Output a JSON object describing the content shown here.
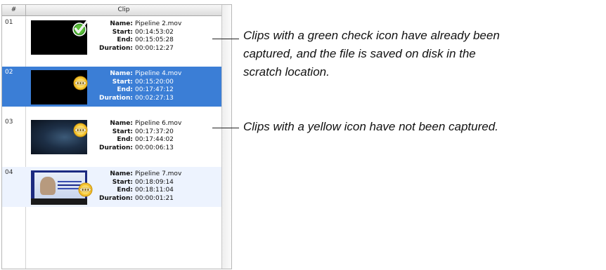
{
  "table": {
    "col_number": "#",
    "col_clip": "Clip",
    "field_labels": {
      "name": "Name:",
      "start": "Start:",
      "end": "End:",
      "duration": "Duration:"
    },
    "rows": [
      {
        "number": "01",
        "name": "Pipeline 2.mov",
        "start": "00:14:53:02",
        "end": "00:15:05:28",
        "duration": "00:00:12:27",
        "status": "captured",
        "icon": "green-check-icon"
      },
      {
        "number": "02",
        "name": "Pipeline 4.mov",
        "start": "00:15:20:00",
        "end": "00:17:47:12",
        "duration": "00:02:27:13",
        "status": "not-captured",
        "icon": "yellow-icon",
        "selected": true
      },
      {
        "number": "03",
        "name": "Pipeline 6.mov",
        "start": "00:17:37:20",
        "end": "00:17:44:02",
        "duration": "00:00:06:13",
        "status": "not-captured",
        "icon": "yellow-icon"
      },
      {
        "number": "04",
        "name": "Pipeline 7.mov",
        "start": "00:18:09:14",
        "end": "00:18:11:04",
        "duration": "00:00:01:21",
        "status": "not-captured",
        "icon": "yellow-icon"
      }
    ]
  },
  "callouts": {
    "green_check": [
      "Clips with a green check icon have already been",
      "captured, and the file is saved on disk in the",
      "scratch location."
    ],
    "yellow": "Clips with a yellow icon have not been captured."
  },
  "colors": {
    "selection": "#3b7ed6",
    "alt_row": "#edf3fe",
    "check_green": "#3f9d2a",
    "icon_yellow": "#f3c12e"
  }
}
